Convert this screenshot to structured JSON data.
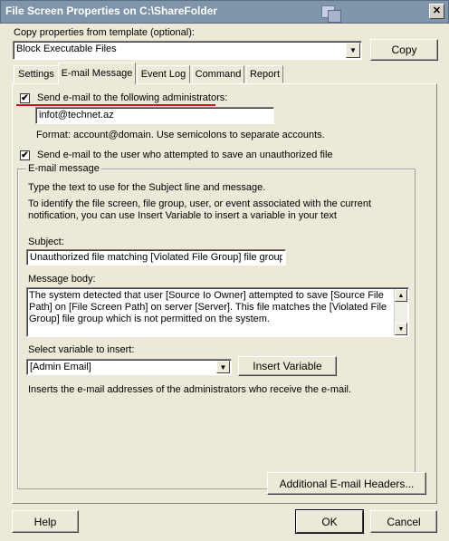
{
  "window": {
    "title": "File Screen Properties on C:\\ShareFolder",
    "close_label": "✕"
  },
  "template": {
    "label": "Copy properties from template (optional):",
    "selected": "Block Executable Files",
    "copy_label": "Copy"
  },
  "tabs": [
    {
      "label": "Settings"
    },
    {
      "label": "E-mail Message"
    },
    {
      "label": "Event Log"
    },
    {
      "label": "Command"
    },
    {
      "label": "Report"
    }
  ],
  "admins": {
    "checkbox_label": "Send e-mail to the following administrators:",
    "checked_mark": "✔",
    "value": "infot@technet.az",
    "format_hint": "Format: account@domain. Use semicolons to separate accounts."
  },
  "user_notify": {
    "checkbox_label": "Send e-mail to the user who attempted to save an unauthorized file",
    "checked_mark": "✔"
  },
  "email_message": {
    "legend": "E-mail message",
    "intro": "Type the text to use for the Subject line and message.",
    "variable_help": "To identify the file screen, file group, user, or event associated with the current notification, you can use Insert Variable to insert a variable in your text",
    "subject_label": "Subject:",
    "subject_value": "Unauthorized file matching [Violated File Group] file group de",
    "body_label": "Message body:",
    "body_value": "The system detected that user [Source Io Owner] attempted to save [Source File Path] on [File Screen Path] on server [Server]. This file matches the [Violated File Group] file group which is not permitted on the system.",
    "variable_label": "Select variable to insert:",
    "variable_selected": "[Admin Email]",
    "insert_label": "Insert Variable",
    "variable_desc": "Inserts the e-mail addresses of the administrators who receive the e-mail."
  },
  "additional_headers_label": "Additional E-mail Headers...",
  "footer": {
    "help": "Help",
    "ok": "OK",
    "cancel": "Cancel"
  },
  "colors": {
    "underline_annotation": "#d01020",
    "title_bar": "#7f95a9"
  }
}
